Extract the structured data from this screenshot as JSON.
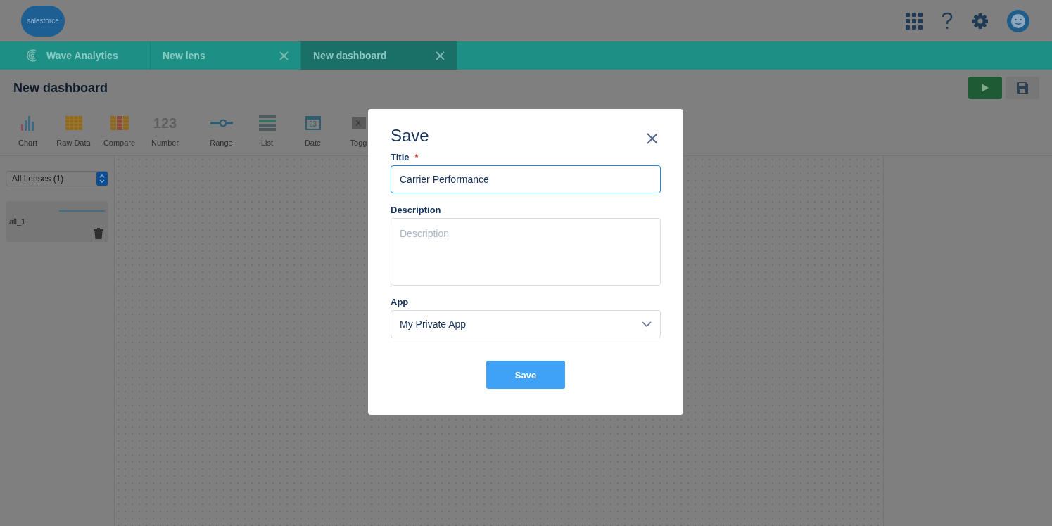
{
  "header": {
    "logo": "salesforce"
  },
  "tabs": [
    {
      "label": "Wave Analytics",
      "kind": "home",
      "selected": false
    },
    {
      "label": "New lens",
      "kind": "closable",
      "selected": false
    },
    {
      "label": "New dashboard",
      "kind": "closable",
      "selected": true
    }
  ],
  "page": {
    "title": "New dashboard"
  },
  "widgets": [
    {
      "label": "Chart",
      "kind": "chart"
    },
    {
      "label": "Raw Data",
      "kind": "rawdata"
    },
    {
      "label": "Compare",
      "kind": "compare"
    },
    {
      "label": "Number",
      "kind": "number",
      "icon_text": "123"
    },
    {
      "label": "Range",
      "kind": "range"
    },
    {
      "label": "List",
      "kind": "list"
    },
    {
      "label": "Date",
      "kind": "date",
      "icon_text": "23"
    },
    {
      "label": "Togg",
      "kind": "toggle",
      "icon_text": "X"
    }
  ],
  "sidebar": {
    "filter": "All Lenses (1)",
    "lenses": [
      {
        "name": "all_1"
      }
    ]
  },
  "dialog": {
    "title": "Save",
    "fields": [
      {
        "label": "Title",
        "kind": "text",
        "required_mark": "*",
        "value": "Carrier Performance",
        "focused": true
      },
      {
        "label": "Description",
        "kind": "textarea",
        "placeholder": "Description",
        "focused": false
      },
      {
        "label": "App",
        "kind": "select",
        "value": "My Private App",
        "focused": false
      }
    ],
    "button": "Save"
  }
}
